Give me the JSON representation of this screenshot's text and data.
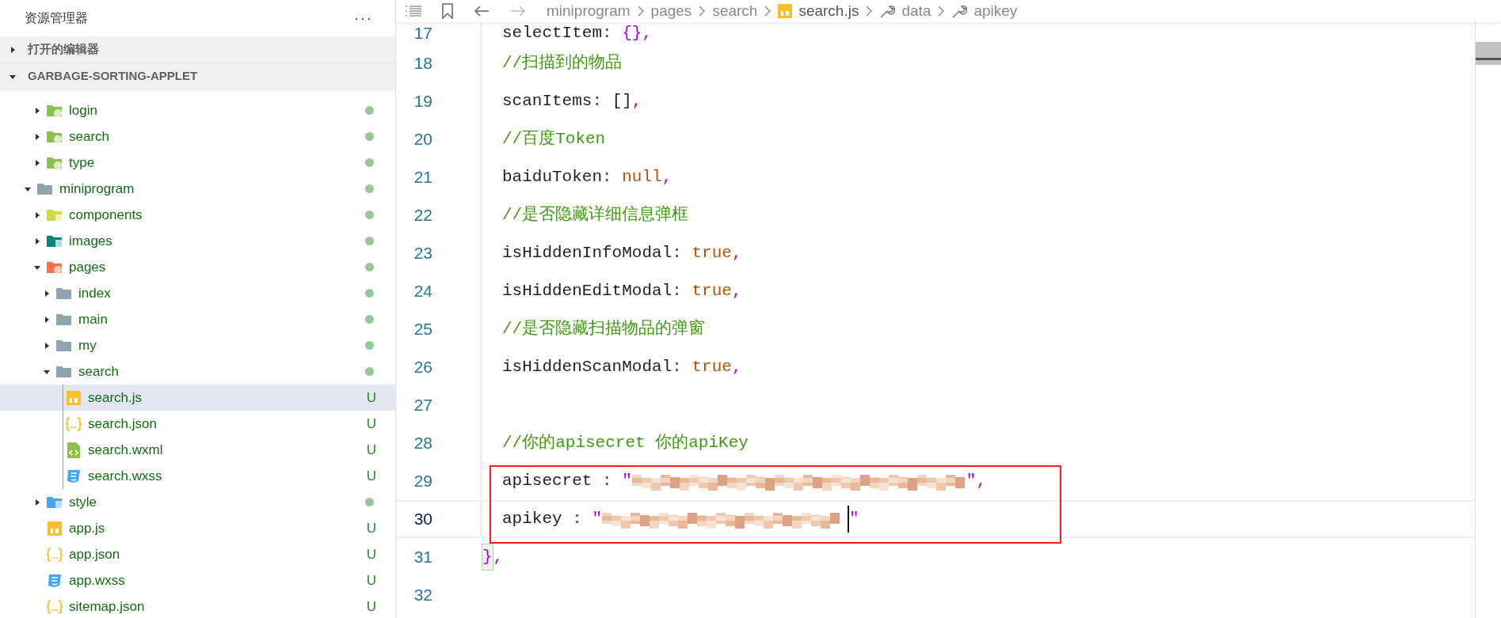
{
  "sidebar": {
    "title": "资源管理器",
    "more": "···",
    "sections": [
      {
        "label": "打开的编辑器",
        "expanded": false
      },
      {
        "label": "GARBAGE-SORTING-APPLET",
        "expanded": true
      }
    ],
    "tree": [
      {
        "kind": "cut-folder",
        "children": [
          {
            "name": "login",
            "kind": "folder-lime",
            "expanded": false,
            "dot": true
          },
          {
            "name": "search",
            "kind": "folder-lime",
            "expanded": false,
            "dot": true
          },
          {
            "name": "type",
            "kind": "folder-lime",
            "expanded": false,
            "dot": true
          }
        ]
      },
      {
        "name": "miniprogram",
        "kind": "folder-grey",
        "expanded": true,
        "dot": true,
        "children": [
          {
            "name": "components",
            "kind": "folder-components",
            "expanded": false,
            "dot": true
          },
          {
            "name": "images",
            "kind": "folder-images",
            "expanded": false,
            "dot": true
          },
          {
            "name": "pages",
            "kind": "folder-pages",
            "expanded": true,
            "dot": true,
            "children": [
              {
                "name": "index",
                "kind": "folder-grey",
                "expanded": false,
                "dot": true
              },
              {
                "name": "main",
                "kind": "folder-grey",
                "expanded": false,
                "dot": true
              },
              {
                "name": "my",
                "kind": "folder-grey",
                "expanded": false,
                "dot": true
              },
              {
                "name": "search",
                "kind": "folder-grey",
                "expanded": true,
                "dot": true,
                "children": [
                  {
                    "name": "search.js",
                    "kind": "js",
                    "badge": "U",
                    "selected": true
                  },
                  {
                    "name": "search.json",
                    "kind": "json",
                    "badge": "U",
                    "selected": false
                  },
                  {
                    "name": "search.wxml",
                    "kind": "wxml",
                    "badge": "U",
                    "selected": false
                  },
                  {
                    "name": "search.wxss",
                    "kind": "wxss",
                    "badge": "U",
                    "selected": false
                  }
                ]
              }
            ]
          },
          {
            "name": "style",
            "kind": "folder-style",
            "expanded": false,
            "dot": true
          },
          {
            "name": "app.js",
            "kind": "js",
            "badge": "U",
            "selected": false
          },
          {
            "name": "app.json",
            "kind": "json",
            "badge": "U",
            "selected": false
          },
          {
            "name": "app.wxss",
            "kind": "wxss",
            "badge": "U",
            "selected": false
          },
          {
            "name": "sitemap.json",
            "kind": "json",
            "badge": "U",
            "selected": false
          }
        ]
      }
    ]
  },
  "breadcrumb": [
    {
      "label": "miniprogram",
      "kind": "folder"
    },
    {
      "label": "pages",
      "kind": "folder"
    },
    {
      "label": "search",
      "kind": "folder"
    },
    {
      "label": "search.js",
      "kind": "file"
    },
    {
      "label": "data",
      "kind": "symbol"
    },
    {
      "label": "apikey",
      "kind": "symbol"
    }
  ],
  "editor": {
    "lines": [
      {
        "number": "17",
        "kind": "body",
        "current": false,
        "tokens": [
          {
            "kind": "key",
            "text": "selectItem"
          },
          {
            "kind": "op",
            "text": ": "
          },
          {
            "kind": "bracket",
            "text": "{}"
          },
          {
            "kind": "punct",
            "text": ","
          }
        ]
      },
      {
        "number": "18",
        "kind": "body",
        "current": false,
        "tokens": [
          {
            "kind": "comment",
            "text": "//扫描到的物品"
          }
        ]
      },
      {
        "number": "19",
        "kind": "body",
        "current": false,
        "tokens": [
          {
            "kind": "key",
            "text": "scanItems"
          },
          {
            "kind": "op",
            "text": ": "
          },
          {
            "kind": "key",
            "text": "[]"
          },
          {
            "kind": "punct",
            "text": ","
          }
        ]
      },
      {
        "number": "20",
        "kind": "body",
        "current": false,
        "tokens": [
          {
            "kind": "comment",
            "text": "//百度Token"
          }
        ]
      },
      {
        "number": "21",
        "kind": "body",
        "current": false,
        "tokens": [
          {
            "kind": "key",
            "text": "baiduToken"
          },
          {
            "kind": "op",
            "text": ": "
          },
          {
            "kind": "keyword",
            "text": "null"
          },
          {
            "kind": "punct",
            "text": ","
          }
        ]
      },
      {
        "number": "22",
        "kind": "body",
        "current": false,
        "tokens": [
          {
            "kind": "comment",
            "text": "//是否隐藏详细信息弹框"
          }
        ]
      },
      {
        "number": "23",
        "kind": "body",
        "current": false,
        "tokens": [
          {
            "kind": "key",
            "text": "isHiddenInfoModal"
          },
          {
            "kind": "op",
            "text": ": "
          },
          {
            "kind": "keyword",
            "text": "true"
          },
          {
            "kind": "punct",
            "text": ","
          }
        ]
      },
      {
        "number": "24",
        "kind": "body",
        "current": false,
        "tokens": [
          {
            "kind": "key",
            "text": "isHiddenEditModal"
          },
          {
            "kind": "op",
            "text": ": "
          },
          {
            "kind": "keyword",
            "text": "true"
          },
          {
            "kind": "punct",
            "text": ","
          }
        ]
      },
      {
        "number": "25",
        "kind": "body",
        "current": false,
        "tokens": [
          {
            "kind": "comment",
            "text": "//是否隐藏扫描物品的弹窗"
          }
        ]
      },
      {
        "number": "26",
        "kind": "body",
        "current": false,
        "tokens": [
          {
            "kind": "key",
            "text": "isHiddenScanModal"
          },
          {
            "kind": "op",
            "text": ": "
          },
          {
            "kind": "keyword",
            "text": "true"
          },
          {
            "kind": "punct",
            "text": ","
          }
        ]
      },
      {
        "number": "27",
        "kind": "body",
        "current": false
      },
      {
        "number": "28",
        "kind": "body",
        "current": false,
        "tokens": [
          {
            "kind": "comment",
            "text": "//你的apisecret 你的apiKey"
          }
        ]
      },
      {
        "number": "29",
        "kind": "boxed",
        "current": false,
        "tokens": [
          {
            "kind": "key",
            "text": "apisecret"
          },
          {
            "kind": "op",
            "text": " : "
          },
          {
            "kind": "punct",
            "text": "\""
          },
          {
            "kind": "redacted-long"
          },
          {
            "kind": "punct",
            "text": "\","
          }
        ]
      },
      {
        "number": "30",
        "kind": "boxed",
        "current": true,
        "tokens": [
          {
            "kind": "key",
            "text": "apikey"
          },
          {
            "kind": "op",
            "text": " : "
          },
          {
            "kind": "punct",
            "text": "\""
          },
          {
            "kind": "redacted-short"
          },
          {
            "kind": "cursor"
          },
          {
            "kind": "punct",
            "text": "\""
          }
        ]
      },
      {
        "number": "31",
        "kind": "closing",
        "current": false,
        "tokens": [
          {
            "kind": "bracket-match",
            "text": "}"
          },
          {
            "kind": "punct",
            "text": ","
          }
        ]
      },
      {
        "number": "32",
        "kind": "closing",
        "current": false
      }
    ]
  }
}
